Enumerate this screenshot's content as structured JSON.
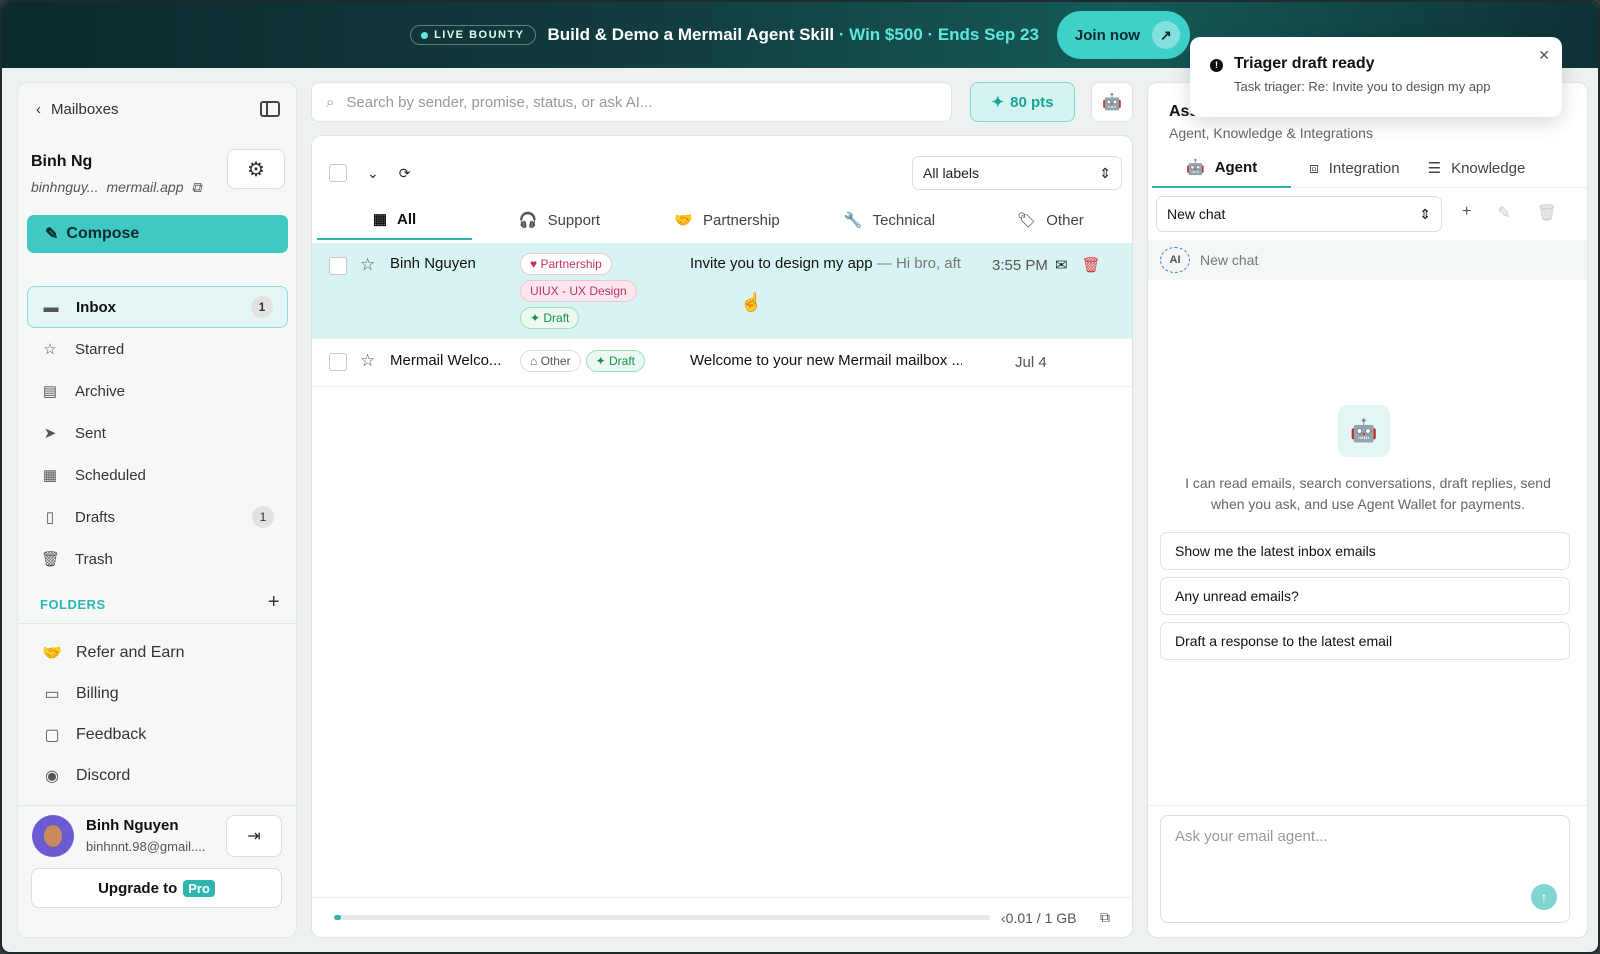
{
  "banner": {
    "live": "LIVE BOUNTY",
    "title": "Build & Demo a Mermail Agent Skill",
    "highlight": " · Win $500 · Ends Sep 23",
    "cta": "Join now"
  },
  "toast": {
    "title": "Triager draft ready",
    "subtitle": "Task triager: Re: Invite you to design my app"
  },
  "sidebar": {
    "back_label": "Mailboxes",
    "user_name": "Binh Ng",
    "user_mail_prefix": "binhnguy...",
    "user_mail_domain": "mermail.app",
    "compose": "Compose",
    "nav": [
      {
        "label": "Inbox",
        "badge": "1",
        "icon": "inbox-icon"
      },
      {
        "label": "Starred",
        "badge": "",
        "icon": "star-icon"
      },
      {
        "label": "Archive",
        "badge": "",
        "icon": "archive-icon"
      },
      {
        "label": "Sent",
        "badge": "",
        "icon": "send-icon"
      },
      {
        "label": "Scheduled",
        "badge": "",
        "icon": "calendar-icon"
      },
      {
        "label": "Drafts",
        "badge": "1",
        "icon": "file-icon"
      },
      {
        "label": "Trash",
        "badge": "",
        "icon": "trash-icon"
      }
    ],
    "folders_label": "FOLDERS",
    "folders": [
      {
        "label": "Refer and Earn"
      },
      {
        "label": "Billing"
      },
      {
        "label": "Feedback"
      },
      {
        "label": "Discord"
      }
    ],
    "footer_name": "Binh Nguyen",
    "footer_mail": "binhnnt.98@gmail....",
    "upgrade": "Upgrade to",
    "pro": "Pro"
  },
  "search": {
    "placeholder": "Search by sender, promise, status, or ask AI..."
  },
  "points": "80 pts",
  "mail": {
    "labels_select": "All labels",
    "tabs": [
      "All",
      "Support",
      "Partnership",
      "Technical",
      "Other"
    ],
    "rows": [
      {
        "sender": "Binh Nguyen",
        "tags": [
          "Partnership",
          "UIUX - UX Design",
          "Draft"
        ],
        "subject": "Invite you to design my app",
        "preview": " — Hi bro, aft...",
        "time": "3:55 PM"
      },
      {
        "sender": "Mermail Welco...",
        "tags": [
          "Other",
          "Draft"
        ],
        "subject": "Welcome to your new Mermail mailbox ...",
        "preview": "",
        "time": "Jul 4"
      }
    ],
    "storage": "‹0.01 / 1 GB",
    "storage_fraction": 0.01
  },
  "assistant": {
    "title": "Ass",
    "subtitle": "Agent, Knowledge & Integrations",
    "tabs": [
      "Agent",
      "Integration",
      "Knowledge"
    ],
    "chat_select": "New chat",
    "new_chat_label": "New chat",
    "ai_badge": "AI",
    "intro": "I can read emails, search conversations, draft replies, send when you ask, and use Agent Wallet for payments.",
    "suggestions": [
      "Show me the latest inbox emails",
      "Any unread emails?",
      "Draft a response to the latest email"
    ],
    "ask_placeholder": "Ask your email agent..."
  }
}
